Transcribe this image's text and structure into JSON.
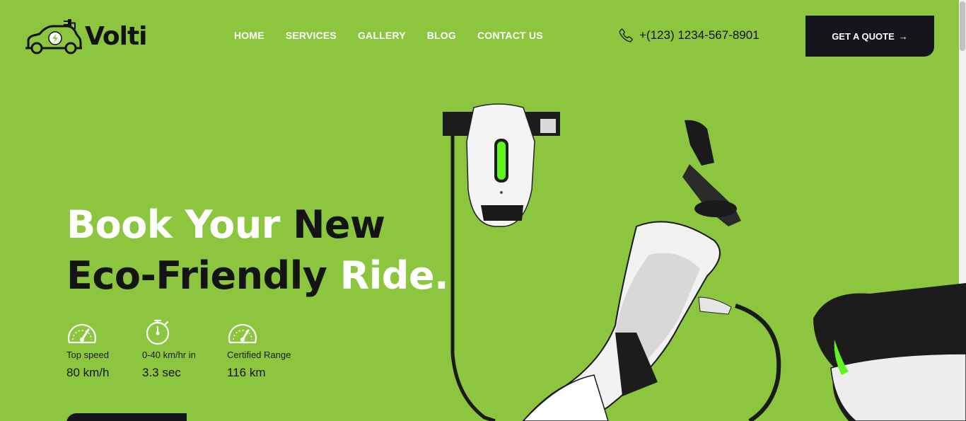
{
  "brand": {
    "name": "Volti"
  },
  "nav": {
    "home": "HOME",
    "services": "SERVICES",
    "gallery": "GALLERY",
    "blog": "BLOG",
    "contact": "CONTACT US"
  },
  "contact": {
    "phone": "+(123) 1234-567-8901"
  },
  "header": {
    "cta_label": "GET A QUOTE",
    "cta_arrow": "→"
  },
  "hero": {
    "line1_part1": "Book Your ",
    "line1_part2": "New",
    "line2_part1": "Eco-Friendly ",
    "line2_part2": "Ride.",
    "stats": [
      {
        "label": "Top speed",
        "value": "80 km/h",
        "icon": "speedometer-icon"
      },
      {
        "label": "0-40 km/hr in",
        "value": "3.3 sec",
        "icon": "stopwatch-icon"
      },
      {
        "label": "Certified Range",
        "value": "116 km",
        "icon": "gauge-icon"
      }
    ]
  },
  "colors": {
    "background": "#8cc63f",
    "dark": "#15151c",
    "light": "#ffffff"
  }
}
